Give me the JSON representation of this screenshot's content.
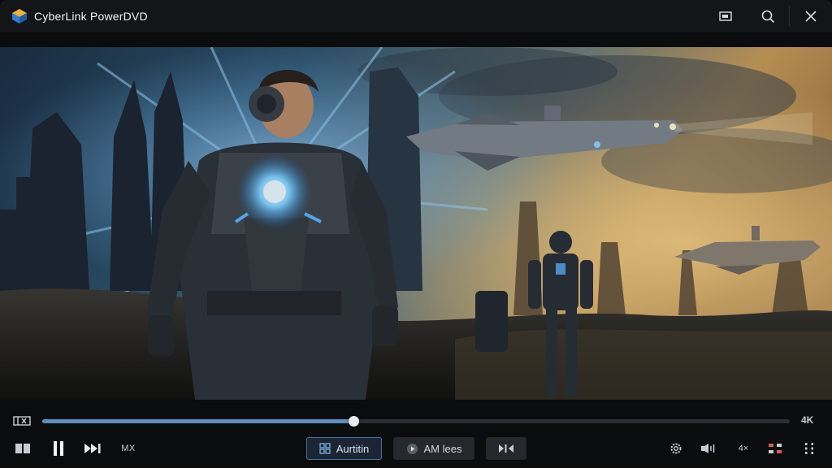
{
  "app": {
    "title": "CyberLink PowerDVD"
  },
  "window_controls": {
    "icons": [
      "minimize-to-tray-icon",
      "search-icon",
      "close-icon"
    ]
  },
  "video": {
    "scene": "sci-fi armored soldier, spaceships, ruined city at dusk"
  },
  "playback": {
    "progress": 0.416,
    "quality_badge": "4K"
  },
  "controls": {
    "mx_label": "MX",
    "audition_label": "Aurtitin",
    "am_label": "AM lees",
    "speed_label": "4×"
  },
  "colors": {
    "accent": "#5c8fc4",
    "active_border": "#3f74a7",
    "titlebar_bg": "#141518",
    "controls_bg": "#0b0c0e"
  }
}
